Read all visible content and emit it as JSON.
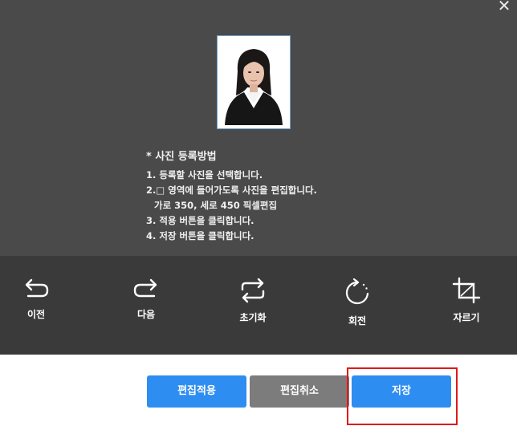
{
  "close_icon": "close-icon",
  "instructions": {
    "heading": "* 사진 등록방법",
    "lines": [
      "1. 등록할 사진을 선택합니다.",
      "2.□ 영역에 들어가도록 사진을 편집합니다.",
      "가로 350, 세로 450 픽셀편집",
      "3. 적용 버튼을 클릭합니다.",
      "4. 저장 버튼을 클릭합니다."
    ]
  },
  "toolbar": {
    "undo": {
      "label": "이전",
      "icon": "undo-icon"
    },
    "redo": {
      "label": "다음",
      "icon": "redo-icon"
    },
    "reset": {
      "label": "초기화",
      "icon": "reset-icon"
    },
    "rotate": {
      "label": "회전",
      "icon": "rotate-icon"
    },
    "crop": {
      "label": "자르기",
      "icon": "crop-icon"
    }
  },
  "actions": {
    "apply_label": "편집적용",
    "cancel_label": "편집취소",
    "save_label": "저장"
  },
  "colors": {
    "accent": "#2e8df0",
    "cancel": "#7c7c7c",
    "editor_bg": "#4a4a4a",
    "toolbar_bg": "#3a3a3a",
    "highlight": "#e01818"
  }
}
